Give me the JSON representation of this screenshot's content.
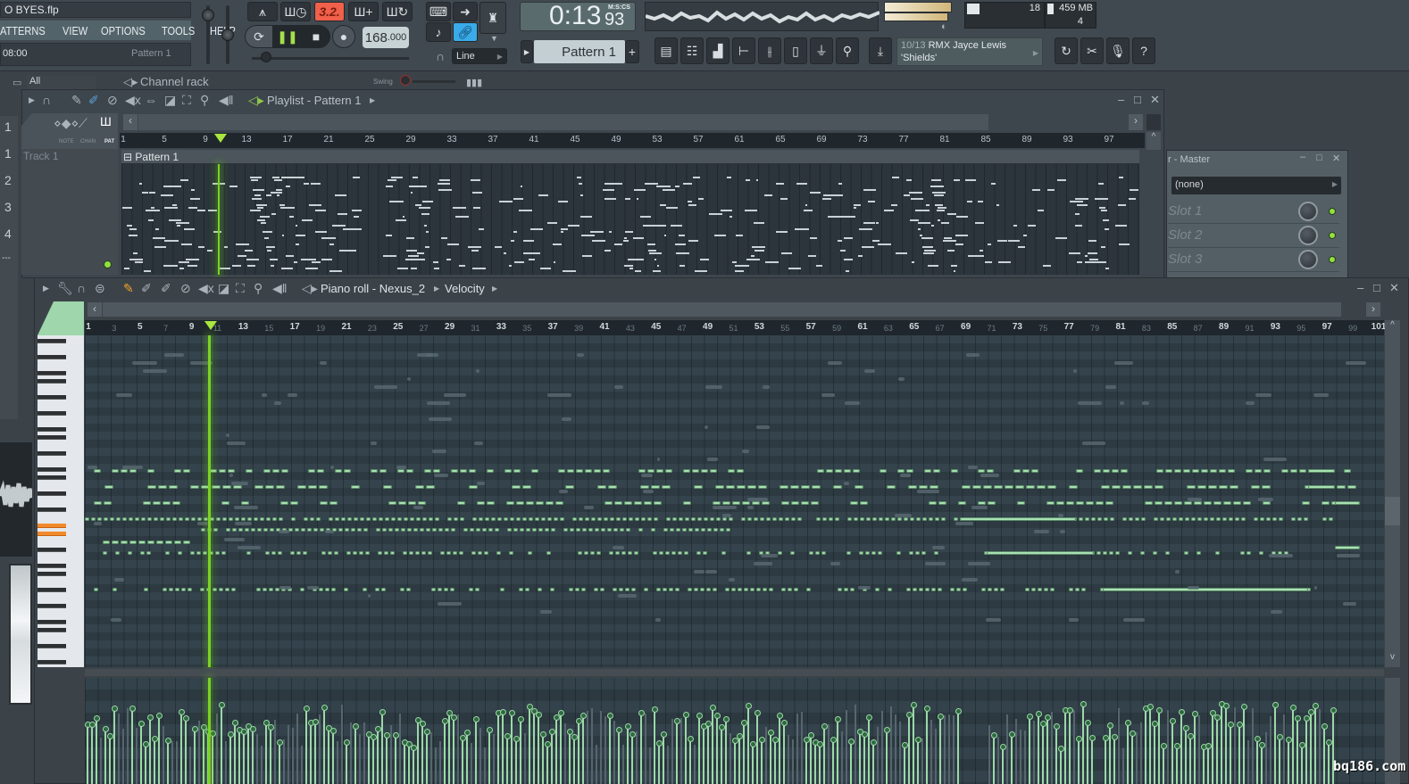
{
  "app": {
    "file_title": "O BYES.flp",
    "menu": [
      "ATTERNS",
      "VIEW",
      "OPTIONS",
      "TOOLS",
      "HELP"
    ],
    "hint_time": "08:00",
    "hint_pattern": "Pattern 1"
  },
  "transport": {
    "snap_label": "3.2.",
    "tempo": "168",
    "tempo_decimals": ".000",
    "time_main": "0:13",
    "time_cs": "93",
    "time_format": "M:S:CS",
    "pattern": "Pattern 1",
    "add_pattern": "+",
    "snap_mode": "Line",
    "cpu_value": "18",
    "memory": "459 MB",
    "polyphony": "4",
    "hint_line1_index": "10/13",
    "hint_line1_text": "RMX Jayce Lewis",
    "hint_line2": "'Shields'",
    "help": "?",
    "colors": {
      "snap_active": "#f0604a",
      "link_active": "#3aaae8",
      "accent_green": "#7bd321"
    }
  },
  "channel_rack": {
    "filter": "All",
    "title": "Channel rack",
    "swing_label": "Swing",
    "rows": [
      "1",
      "1",
      "2",
      "3",
      "4",
      "---"
    ]
  },
  "playlist": {
    "title": "Playlist - Pattern 1",
    "tabs": [
      "NOTE",
      "CHAN",
      "PAT"
    ],
    "track": "Track 1",
    "clip": "Pattern 1",
    "ruler": [
      "1",
      "5",
      "9",
      "13",
      "17",
      "21",
      "25",
      "29",
      "33",
      "37",
      "41",
      "45",
      "49",
      "53",
      "57",
      "61",
      "65",
      "69",
      "73",
      "77",
      "81",
      "85",
      "89",
      "93",
      "97"
    ]
  },
  "mixer": {
    "title": "r - Master",
    "insert": "(none)",
    "slots": [
      "Slot 1",
      "Slot 2",
      "Slot 3"
    ]
  },
  "piano_roll": {
    "title": "Piano roll - Nexus_2",
    "target": "Velocity",
    "ruler": [
      "1",
      "3",
      "5",
      "7",
      "9",
      "11",
      "13",
      "15",
      "17",
      "19",
      "21",
      "23",
      "25",
      "27",
      "29",
      "31",
      "33",
      "35",
      "37",
      "39",
      "41",
      "43",
      "45",
      "47",
      "49",
      "51",
      "53",
      "55",
      "57",
      "59",
      "61",
      "63",
      "65",
      "67",
      "69",
      "71",
      "73",
      "75",
      "77",
      "79",
      "81",
      "83",
      "85",
      "87",
      "89",
      "91",
      "93",
      "95",
      "97",
      "99",
      "101"
    ],
    "playhead_bar": 10.3
  },
  "watermark": "bq186.com"
}
